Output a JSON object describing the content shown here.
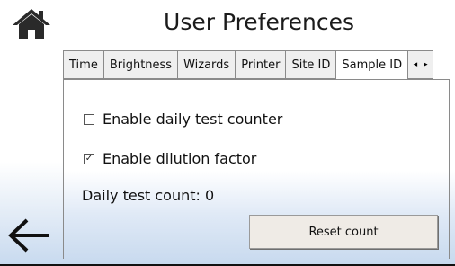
{
  "header": {
    "title": "User Preferences"
  },
  "nav": {
    "home_icon": "home-icon",
    "back_icon": "arrow-left-icon"
  },
  "tabs": [
    {
      "label": "Time"
    },
    {
      "label": "Brightness"
    },
    {
      "label": "Wizards"
    },
    {
      "label": "Printer"
    },
    {
      "label": "Site ID"
    },
    {
      "label": "Sample ID",
      "active": true
    }
  ],
  "tab_scroll": {
    "left": "◂",
    "right": "▸"
  },
  "settings": {
    "daily_counter": {
      "label": "Enable daily test counter",
      "checked": false
    },
    "dilution": {
      "label": "Enable dilution factor",
      "checked": true
    },
    "count_text": "Daily test count: 0",
    "reset_label": "Reset count"
  }
}
